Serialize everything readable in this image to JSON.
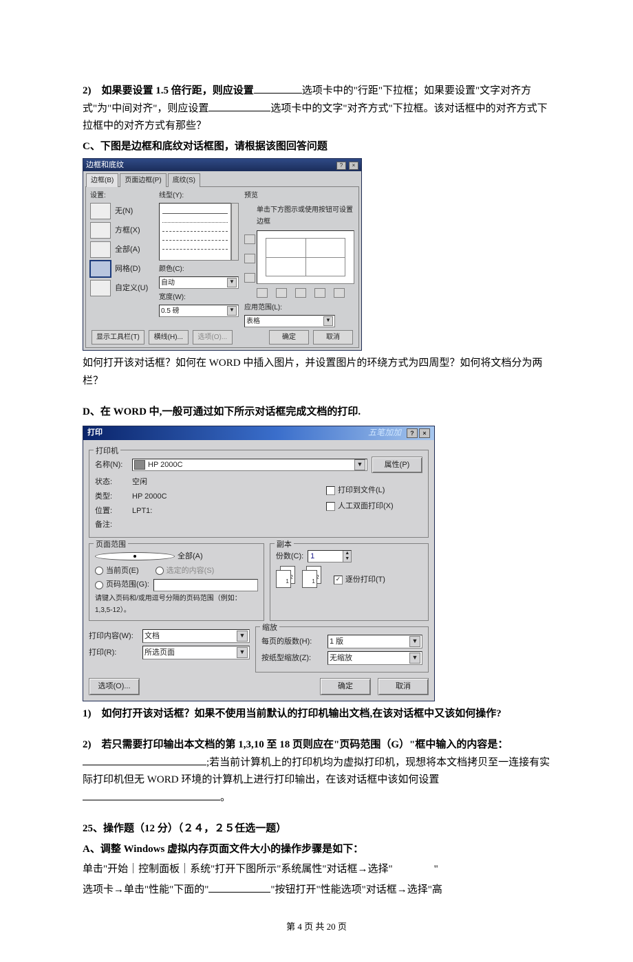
{
  "q2": {
    "lead": "2)　如果要设置 1.5 倍行距，则应设置",
    "mid1": "选项卡中的\"行距\"下拉框；如果要设置\"文字对齐方式\"为\"中间对齐\"，则应设置",
    "mid2": "选项卡中的文字\"对齐方式\"下拉框。该对话框中的对齐方式下拉框中的对齐方式有那些？"
  },
  "qc": "C、下图是边框和底纹对话框图，请根据该图回答问题",
  "dlg1": {
    "title": "边框和底纹",
    "tabs": [
      "边框(B)",
      "页面边框(P)",
      "底纹(S)"
    ],
    "settings_label": "设置:",
    "settings": [
      {
        "label": "无(N)"
      },
      {
        "label": "方框(X)"
      },
      {
        "label": "全部(A)"
      },
      {
        "label": "网格(D)"
      },
      {
        "label": "自定义(U)"
      }
    ],
    "style_label": "线型(Y):",
    "color_label": "颜色(C):",
    "color_value": "自动",
    "width_label": "宽度(W):",
    "width_value": "0.5 磅",
    "preview_label": "预览",
    "preview_hint": "单击下方图示或使用按钮可设置边框",
    "apply_label": "应用范围(L):",
    "apply_value": "表格",
    "toolbar_btn": "显示工具栏(T)",
    "hline_btn": "横线(H)...",
    "options_btn": "选项(O)...",
    "ok": "确定",
    "cancel": "取消"
  },
  "after1": "如何打开该对话框？如何在 WORD 中插入图片，并设置图片的环绕方式为四周型？如何将文档分为两栏？",
  "qd": "D、在 WORD 中,一般可通过如下所示对话框完成文档的打印.",
  "dlg2": {
    "title": "打印",
    "sig": "五笔加加",
    "printer_group": "打印机",
    "name_label": "名称(N):",
    "name_value": "HP 2000C",
    "props_btn": "属性(P)",
    "status_label": "状态:",
    "status_value": "空闲",
    "type_label": "类型:",
    "type_value": "HP 2000C",
    "loc_label": "位置:",
    "loc_value": "LPT1:",
    "note_label": "备注:",
    "print_to_file": "打印到文件(L)",
    "manual_duplex": "人工双面打印(X)",
    "range_group": "页面范围",
    "range_all": "全部(A)",
    "range_current": "当前页(E)",
    "range_selection": "选定的内容(S)",
    "range_pages": "页码范围(G):",
    "range_hint": "请键入页码和/或用逗号分隔的页码范围（例如：1,3,5-12）。",
    "copies_group": "副本",
    "copies_label": "份数(C):",
    "copies_value": "1",
    "collate": "逐份打印(T)",
    "content_label": "打印内容(W):",
    "content_value": "文档",
    "print_label": "打印(R):",
    "print_value": "所选页面",
    "zoom_group": "缩放",
    "per_sheet_label": "每页的版数(H):",
    "per_sheet_value": "1 版",
    "scale_label": "按纸型缩放(Z):",
    "scale_value": "无缩放",
    "options_btn": "选项(O)...",
    "ok": "确定",
    "cancel": "取消"
  },
  "q_d1_lead": "1)　如何打开该对话框？如果不使用当前默认的打印机输出文档,在该对话框中又该如何操作?",
  "q_d2": {
    "lead": "2)　若只需要打印输出本文档的第 1,3,10 至 18 页则应在\"页码范围（G）\"框中输入的内容是：",
    "mid": ";若当前计算机上的打印机均为虚拟打印机，现想将本文档拷贝至一连接有实际打印机但无 WORD 环境的计算机上进行打印输出，在该对话框中该如何设置",
    "end": "。"
  },
  "q25_head": "25、操作题（12 分）（２４，２５任选一题）",
  "q25_a": "A、调整 Windows 虚拟内存页面文件大小的操作步骤是如下：",
  "q25_line1a": "单击\"开始｜控制面板｜系统\"打开下图所示\"系统属性\"对话框→选择\"",
  "q25_line1b": "\"",
  "q25_line2a": "选项卡→单击\"性能\"下面的\"",
  "q25_line2b": "\"按钮打开\"性能选项\"对话框→选择\"高",
  "footer": "第 4 页 共 20 页"
}
